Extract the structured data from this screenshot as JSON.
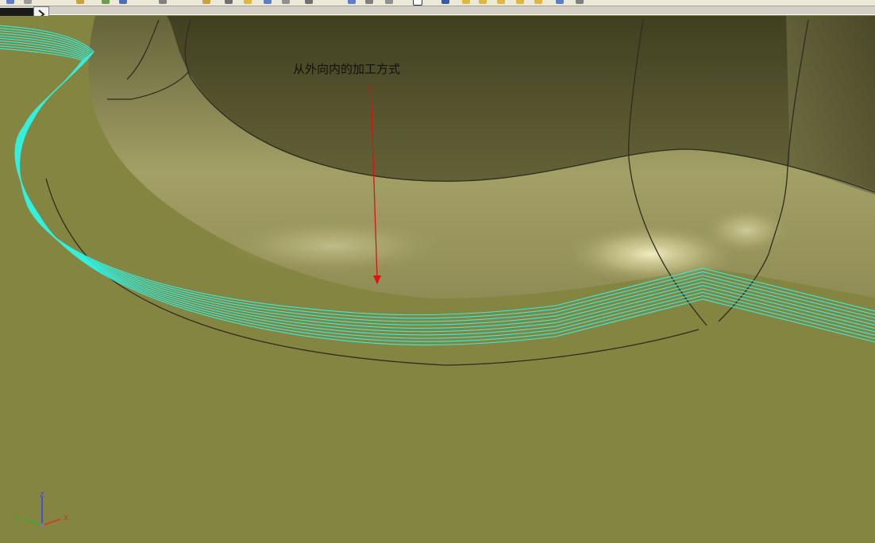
{
  "toolbar": {
    "expand_icon": "chevron-right-icon"
  },
  "viewport": {
    "annotation": "从外向内的加工方式",
    "toolpath_color": "#33f0e0",
    "arrow_color": "#e01010",
    "background_color": "#838540"
  },
  "triad": {
    "z_label": "Z",
    "y_label": "Y",
    "x_label": "X"
  }
}
